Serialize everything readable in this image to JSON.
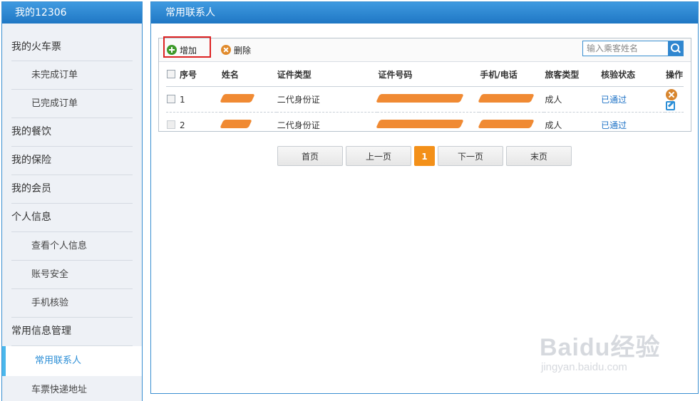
{
  "sidebar": {
    "title": "我的12306",
    "items": [
      {
        "label": "我的火车票",
        "level": 1
      },
      {
        "label": "未完成订单",
        "level": 2
      },
      {
        "label": "已完成订单",
        "level": 2
      },
      {
        "label": "我的餐饮",
        "level": 1
      },
      {
        "label": "我的保险",
        "level": 1
      },
      {
        "label": "我的会员",
        "level": 1
      },
      {
        "label": "个人信息",
        "level": 1
      },
      {
        "label": "查看个人信息",
        "level": 2
      },
      {
        "label": "账号安全",
        "level": 2
      },
      {
        "label": "手机核验",
        "level": 2
      },
      {
        "label": "常用信息管理",
        "level": 1
      },
      {
        "label": "常用联系人",
        "level": 2,
        "active": true
      },
      {
        "label": "车票快递地址",
        "level": 2
      }
    ]
  },
  "main": {
    "title": "常用联系人",
    "toolbar": {
      "add_label": "增加",
      "delete_label": "删除",
      "search_placeholder": "输入乘客姓名"
    },
    "table": {
      "columns": [
        "序号",
        "姓名",
        "证件类型",
        "证件号码",
        "手机/电话",
        "旅客类型",
        "核验状态",
        "操作"
      ],
      "rows": [
        {
          "index": "1",
          "id_type": "二代身份证",
          "passenger_type": "成人",
          "status": "已通过"
        },
        {
          "index": "2",
          "id_type": "二代身份证",
          "passenger_type": "成人",
          "status": "已通过"
        }
      ]
    },
    "pagination": {
      "first": "首页",
      "prev": "上一页",
      "current": "1",
      "next": "下一页",
      "last": "末页"
    }
  },
  "watermark": {
    "brand": "Baidu经验",
    "url": "jingyan.baidu.com"
  },
  "colors": {
    "header_blue": "#2a86d1",
    "accent_orange": "#f39019",
    "redaction": "#f08a33",
    "link_blue": "#1d72c6"
  }
}
